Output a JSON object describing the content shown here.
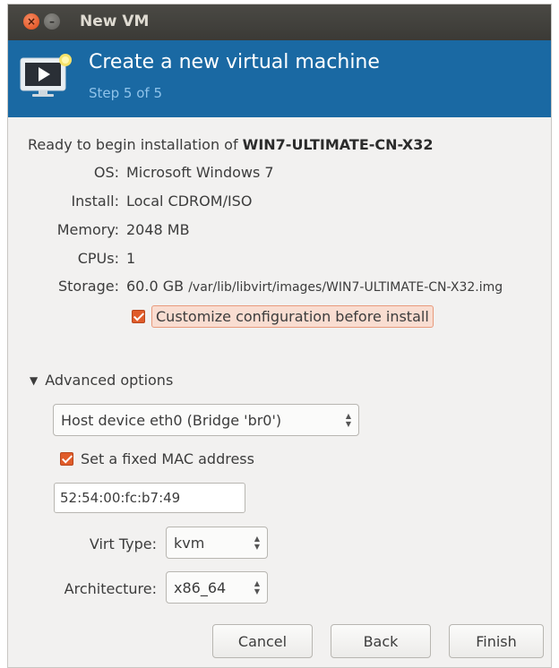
{
  "window": {
    "title": "New VM"
  },
  "header": {
    "title": "Create a new virtual machine",
    "step": "Step 5 of 5"
  },
  "summary": {
    "ready_prefix": "Ready to begin installation of ",
    "vm_name": "WIN7-ULTIMATE-CN-X32",
    "rows": [
      {
        "label": "OS:",
        "value": "Microsoft Windows 7"
      },
      {
        "label": "Install:",
        "value": "Local CDROM/ISO"
      },
      {
        "label": "Memory:",
        "value": "2048 MB"
      },
      {
        "label": "CPUs:",
        "value": "1"
      }
    ],
    "storage": {
      "label": "Storage:",
      "size": "60.0 GB",
      "path": "/var/lib/libvirt/images/WIN7-ULTIMATE-CN-X32.img"
    }
  },
  "customize": {
    "label": "Customize configuration before install",
    "checked": true
  },
  "advanced": {
    "label": "Advanced options",
    "expanded": true,
    "network": "Host device eth0 (Bridge 'br0')",
    "fixed_mac": {
      "label": "Set a fixed MAC address",
      "checked": true
    },
    "mac_value": "52:54:00:fc:b7:49",
    "virt_type": {
      "label": "Virt Type:",
      "value": "kvm"
    },
    "architecture": {
      "label": "Architecture:",
      "value": "x86_64"
    }
  },
  "buttons": {
    "cancel": "Cancel",
    "back": "Back",
    "finish": "Finish"
  },
  "colors": {
    "banner": "#1a69a3",
    "accent_orange": "#e05c2a",
    "titlebar": "#3b3a36"
  },
  "icons": {
    "close": "close-icon",
    "minimize": "minimize-icon",
    "vm": "vm-monitor-icon",
    "expander": "triangle-down-icon",
    "spinner": "spin-arrows-icon"
  }
}
